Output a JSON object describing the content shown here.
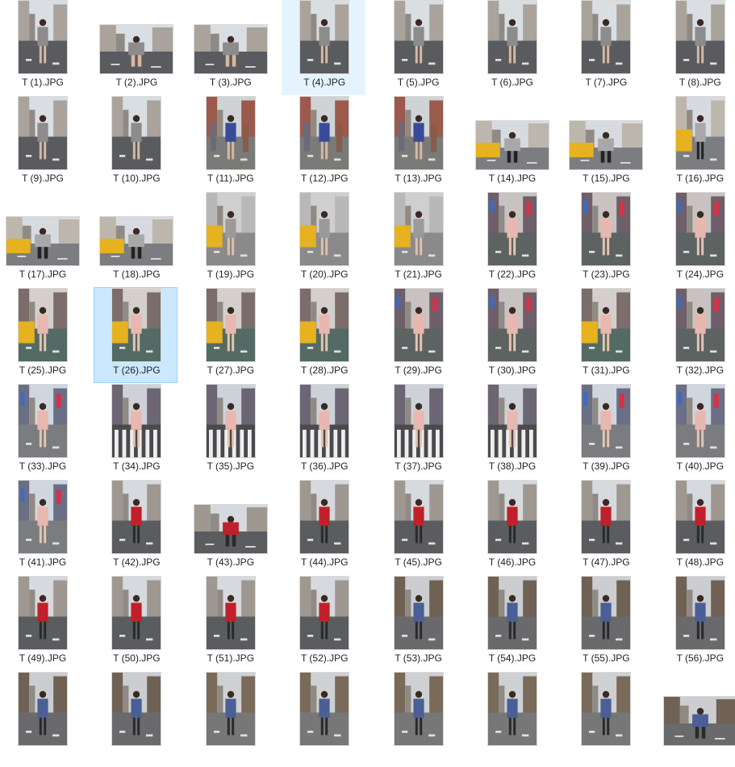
{
  "view": "large-icons",
  "files": [
    {
      "name": "T (1).JPG",
      "orientation": "portrait",
      "scene": "street-grey"
    },
    {
      "name": "T (2).JPG",
      "orientation": "landscape",
      "scene": "street-grey"
    },
    {
      "name": "T (3).JPG",
      "orientation": "landscape",
      "scene": "street-grey"
    },
    {
      "name": "T (4).JPG",
      "orientation": "portrait",
      "scene": "street-grey",
      "state": "hover"
    },
    {
      "name": "T (5).JPG",
      "orientation": "portrait",
      "scene": "street-grey"
    },
    {
      "name": "T (6).JPG",
      "orientation": "portrait",
      "scene": "street-grey"
    },
    {
      "name": "T (7).JPG",
      "orientation": "portrait",
      "scene": "street-grey"
    },
    {
      "name": "T (8).JPG",
      "orientation": "portrait",
      "scene": "street-grey"
    },
    {
      "name": "T (9).JPG",
      "orientation": "portrait",
      "scene": "street-grey"
    },
    {
      "name": "T (10).JPG",
      "orientation": "portrait",
      "scene": "street-grey"
    },
    {
      "name": "T (11).JPG",
      "orientation": "portrait",
      "scene": "crowd"
    },
    {
      "name": "T (12).JPG",
      "orientation": "portrait",
      "scene": "crowd"
    },
    {
      "name": "T (13).JPG",
      "orientation": "portrait",
      "scene": "crowd"
    },
    {
      "name": "T (14).JPG",
      "orientation": "landscape",
      "scene": "taxi"
    },
    {
      "name": "T (15).JPG",
      "orientation": "landscape",
      "scene": "taxi"
    },
    {
      "name": "T (16).JPG",
      "orientation": "portrait",
      "scene": "taxi"
    },
    {
      "name": "T (17).JPG",
      "orientation": "landscape",
      "scene": "taxi"
    },
    {
      "name": "T (18).JPG",
      "orientation": "landscape",
      "scene": "taxi"
    },
    {
      "name": "T (19).JPG",
      "orientation": "portrait",
      "scene": "taxi-close"
    },
    {
      "name": "T (20).JPG",
      "orientation": "portrait",
      "scene": "taxi-close"
    },
    {
      "name": "T (21).JPG",
      "orientation": "portrait",
      "scene": "taxi-close"
    },
    {
      "name": "T (22).JPG",
      "orientation": "portrait",
      "scene": "pink-bus"
    },
    {
      "name": "T (23).JPG",
      "orientation": "portrait",
      "scene": "pink-bus"
    },
    {
      "name": "T (24).JPG",
      "orientation": "portrait",
      "scene": "pink-bus"
    },
    {
      "name": "T (25).JPG",
      "orientation": "portrait",
      "scene": "pink-taxi"
    },
    {
      "name": "T (26).JPG",
      "orientation": "portrait",
      "scene": "pink-taxi",
      "state": "selected"
    },
    {
      "name": "T (27).JPG",
      "orientation": "portrait",
      "scene": "pink-taxi"
    },
    {
      "name": "T (28).JPG",
      "orientation": "portrait",
      "scene": "pink-taxi"
    },
    {
      "name": "T (29).JPG",
      "orientation": "portrait",
      "scene": "pink-bus"
    },
    {
      "name": "T (30).JPG",
      "orientation": "portrait",
      "scene": "pink-bus"
    },
    {
      "name": "T (31).JPG",
      "orientation": "portrait",
      "scene": "pink-taxi"
    },
    {
      "name": "T (32).JPG",
      "orientation": "portrait",
      "scene": "pink-bus"
    },
    {
      "name": "T (33).JPG",
      "orientation": "portrait",
      "scene": "pink-square"
    },
    {
      "name": "T (34).JPG",
      "orientation": "portrait",
      "scene": "pink-crosswalk"
    },
    {
      "name": "T (35).JPG",
      "orientation": "portrait",
      "scene": "pink-crosswalk"
    },
    {
      "name": "T (36).JPG",
      "orientation": "portrait",
      "scene": "pink-crosswalk"
    },
    {
      "name": "T (37).JPG",
      "orientation": "portrait",
      "scene": "pink-crosswalk"
    },
    {
      "name": "T (38).JPG",
      "orientation": "portrait",
      "scene": "pink-crosswalk"
    },
    {
      "name": "T (39).JPG",
      "orientation": "portrait",
      "scene": "pink-square"
    },
    {
      "name": "T (40).JPG",
      "orientation": "portrait",
      "scene": "pink-square"
    },
    {
      "name": "T (41).JPG",
      "orientation": "portrait",
      "scene": "pink-square"
    },
    {
      "name": "T (42).JPG",
      "orientation": "portrait",
      "scene": "red-street"
    },
    {
      "name": "T (43).JPG",
      "orientation": "landscape",
      "scene": "red-street"
    },
    {
      "name": "T (44).JPG",
      "orientation": "portrait",
      "scene": "red-street"
    },
    {
      "name": "T (45).JPG",
      "orientation": "portrait",
      "scene": "red-street"
    },
    {
      "name": "T (46).JPG",
      "orientation": "portrait",
      "scene": "red-street"
    },
    {
      "name": "T (47).JPG",
      "orientation": "portrait",
      "scene": "red-street"
    },
    {
      "name": "T (48).JPG",
      "orientation": "portrait",
      "scene": "red-street"
    },
    {
      "name": "T (49).JPG",
      "orientation": "portrait",
      "scene": "red-street"
    },
    {
      "name": "T (50).JPG",
      "orientation": "portrait",
      "scene": "red-street"
    },
    {
      "name": "T (51).JPG",
      "orientation": "portrait",
      "scene": "red-street"
    },
    {
      "name": "T (52).JPG",
      "orientation": "portrait",
      "scene": "red-street"
    },
    {
      "name": "T (53).JPG",
      "orientation": "portrait",
      "scene": "blue-avenue"
    },
    {
      "name": "T (54).JPG",
      "orientation": "portrait",
      "scene": "blue-avenue"
    },
    {
      "name": "T (55).JPG",
      "orientation": "portrait",
      "scene": "blue-avenue"
    },
    {
      "name": "T (56).JPG",
      "orientation": "portrait",
      "scene": "blue-avenue"
    },
    {
      "name": "",
      "orientation": "portrait",
      "scene": "blue-avenue"
    },
    {
      "name": "",
      "orientation": "portrait",
      "scene": "blue-avenue"
    },
    {
      "name": "",
      "orientation": "portrait",
      "scene": "blue-close"
    },
    {
      "name": "",
      "orientation": "portrait",
      "scene": "blue-close"
    },
    {
      "name": "",
      "orientation": "portrait",
      "scene": "blue-close"
    },
    {
      "name": "",
      "orientation": "portrait",
      "scene": "blue-close"
    },
    {
      "name": "",
      "orientation": "portrait",
      "scene": "blue-close"
    },
    {
      "name": "",
      "orientation": "landscape",
      "scene": "blue-avenue"
    }
  ],
  "colors": {
    "hover_bg": "#e5f3ff",
    "selected_bg": "#cce8ff",
    "selected_border": "#99d1ff",
    "label_text": "#1e1e1e"
  }
}
